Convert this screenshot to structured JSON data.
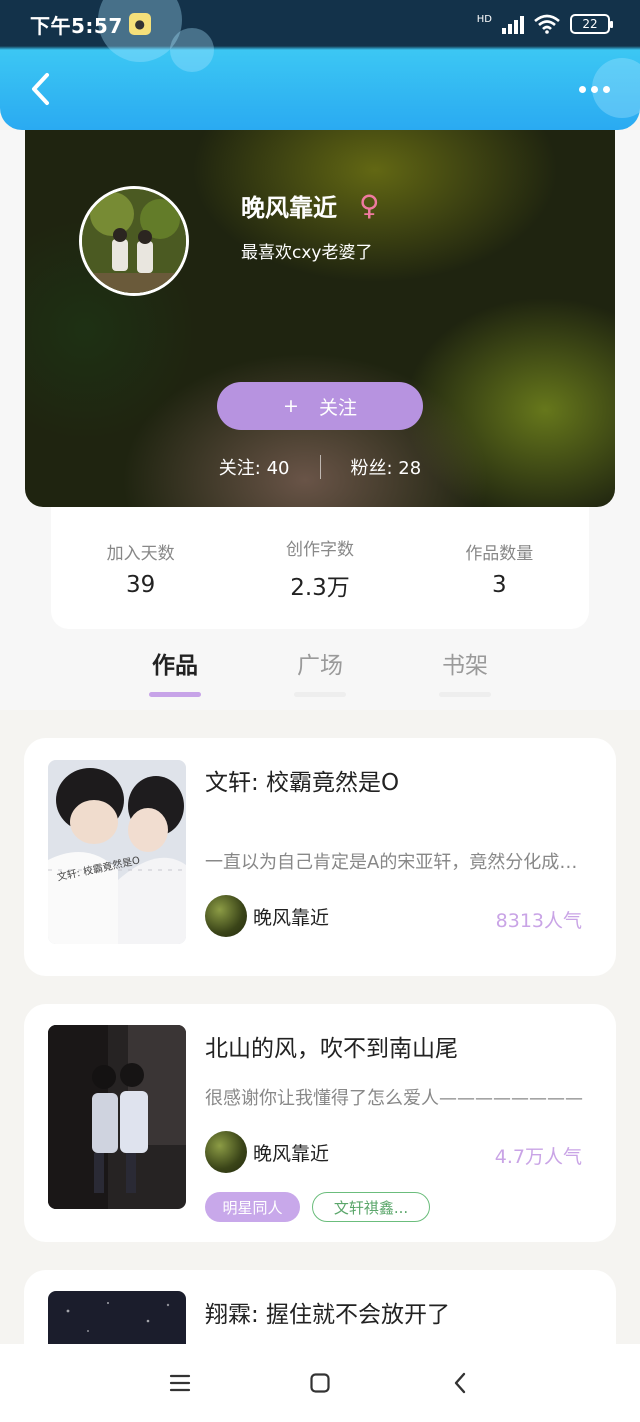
{
  "status_bar": {
    "time": "下午5:57",
    "network": "HD",
    "battery": "22"
  },
  "profile": {
    "name": "晚风靠近",
    "gender_icon": "female-icon",
    "bio": "最喜欢cxy老婆了",
    "follow_button": "+",
    "follow_label": "关注",
    "following": "关注: 40",
    "followers": "粉丝: 28"
  },
  "stats": [
    {
      "label": "加入天数",
      "value": "39"
    },
    {
      "label": "创作字数",
      "value": "2.3万"
    },
    {
      "label": "作品数量",
      "value": "3"
    }
  ],
  "tabs": [
    {
      "label": "作品",
      "active": true
    },
    {
      "label": "广场",
      "active": false
    },
    {
      "label": "书架",
      "active": false
    }
  ],
  "works": [
    {
      "title": "文轩: 校霸竟然是O",
      "description": "一直以为自己肯定是A的宋亚轩，竟然分化成了O",
      "author": "晚风靠近",
      "popularity": "8313人气",
      "cover_text": "文轩: 校霸竟然是O"
    },
    {
      "title": "北山的风，吹不到南山尾",
      "description": "很感谢你让我懂得了怎么爱人————————",
      "author": "晚风靠近",
      "popularity": "4.7万人气",
      "tags": [
        "明星同人",
        "文轩祺鑫..."
      ]
    },
    {
      "title": "翔霖: 握住就不会放开了"
    }
  ],
  "colors": {
    "accent_purple": "#b793e0",
    "header_blue": "#2aaaf2",
    "popularity_purple": "#c9a4e6",
    "tag_green": "#6bbd7c"
  }
}
